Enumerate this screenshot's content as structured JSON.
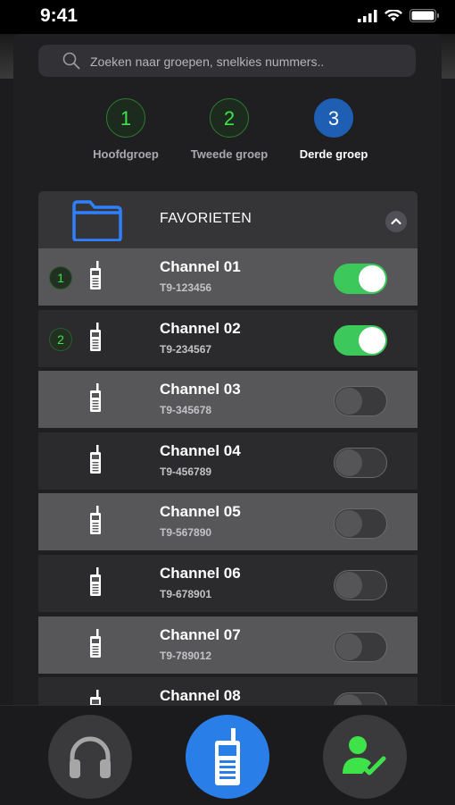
{
  "status": {
    "time": "9:41"
  },
  "search": {
    "placeholder": "Zoeken naar groepen, snelkies nummers.."
  },
  "groups": [
    {
      "number": "1",
      "label": "Hoofdgroep",
      "active": false
    },
    {
      "number": "2",
      "label": "Tweede groep",
      "active": false
    },
    {
      "number": "3",
      "label": "Derde groep",
      "active": true
    }
  ],
  "favorites": {
    "title": "FAVORIETEN"
  },
  "channels": [
    {
      "name": "Channel 01",
      "number": "T9-123456",
      "badge": "1",
      "enabled": true
    },
    {
      "name": "Channel 02",
      "number": "T9-234567",
      "badge": "2",
      "enabled": true
    },
    {
      "name": "Channel 03",
      "number": "T9-345678",
      "badge": "",
      "enabled": false
    },
    {
      "name": "Channel 04",
      "number": "T9-456789",
      "badge": "",
      "enabled": false
    },
    {
      "name": "Channel 05",
      "number": "T9-567890",
      "badge": "",
      "enabled": false
    },
    {
      "name": "Channel 06",
      "number": "T9-678901",
      "badge": "",
      "enabled": false
    },
    {
      "name": "Channel 07",
      "number": "T9-789012",
      "badge": "",
      "enabled": false
    },
    {
      "name": "Channel 08",
      "number": "",
      "badge": "",
      "enabled": false
    }
  ],
  "nav": [
    {
      "icon": "headphones-icon",
      "active": false
    },
    {
      "icon": "radio-icon",
      "active": true
    },
    {
      "icon": "user-check-icon",
      "active": false
    }
  ],
  "colors": {
    "accent_blue": "#2a7ee8",
    "toggle_green": "#3cc85a",
    "badge_green": "#3ee34a"
  }
}
